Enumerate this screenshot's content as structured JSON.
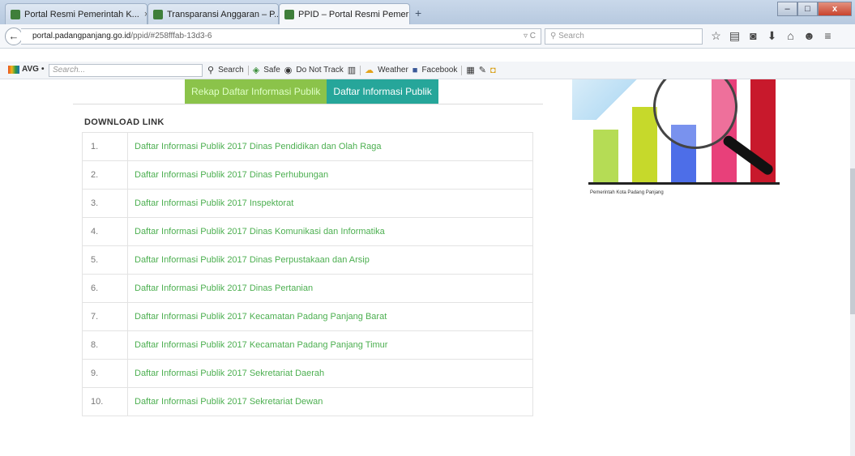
{
  "browser": {
    "tabs": [
      {
        "title": "Portal Resmi Pemerintah K...",
        "close": "×"
      },
      {
        "title": "Transparansi Anggaran – P...",
        "close": "×"
      },
      {
        "title": "PPID – Portal Resmi Pemeri...",
        "close": "×"
      }
    ],
    "new_tab": "+",
    "window_buttons": {
      "minimize": "–",
      "maximize": "□",
      "close": "x"
    },
    "url_host": "portal.padangpanjang.go.id",
    "url_path": "/ppid/#258fffab-13d3-6",
    "url_icons": "▿ C",
    "search_placeholder": "Search",
    "back": "←",
    "icons": [
      "star-icon",
      "bookmarks-icon",
      "pocket-icon",
      "download-icon",
      "home-icon",
      "chat-icon",
      "menu-icon"
    ]
  },
  "avg_toolbar": {
    "logo": "AVG",
    "dropdown": "•",
    "search_placeholder": "Search...",
    "items": [
      "Search",
      "Safe",
      "Do Not Track",
      "Weather",
      "Facebook"
    ]
  },
  "content_tabs": {
    "recap": "Rekap Daftar Informasi Publik",
    "list": "Daftar Informasi Publik"
  },
  "download": {
    "title": "DOWNLOAD LINK",
    "rows": [
      {
        "num": "1.",
        "label": "Daftar Informasi Publik 2017 Dinas Pendidikan dan Olah Raga"
      },
      {
        "num": "2.",
        "label": "Daftar Informasi Publik 2017 Dinas Perhubungan"
      },
      {
        "num": "3.",
        "label": "Daftar Informasi Publik 2017 Inspektorat"
      },
      {
        "num": "4.",
        "label": "Daftar Informasi Publik 2017 Dinas Komunikasi dan Informatika"
      },
      {
        "num": "5.",
        "label": "Daftar Informasi Publik 2017 Dinas Perpustakaan dan Arsip"
      },
      {
        "num": "6.",
        "label": "Daftar Informasi Publik 2017 Dinas Pertanian"
      },
      {
        "num": "7.",
        "label": "Daftar Informasi Publik 2017 Kecamatan Padang Panjang Barat"
      },
      {
        "num": "8.",
        "label": "Daftar Informasi Publik 2017 Kecamatan Padang Panjang Timur"
      },
      {
        "num": "9.",
        "label": "Daftar Informasi Publik 2017 Sekretariat Daerah"
      },
      {
        "num": "10.",
        "label": "Daftar Informasi Publik 2017 Sekretariat Dewan"
      }
    ]
  },
  "banner": {
    "caption": "Pemerintah Kota Padang Panjang",
    "bar_colors": [
      "#b5dc55",
      "#c6d92b",
      "#4d6ee8",
      "#e8407a",
      "#c8192c"
    ]
  },
  "colors": {
    "link_green": "#4caf50",
    "tab_green": "#8bc34a",
    "tab_teal": "#26a69a"
  }
}
